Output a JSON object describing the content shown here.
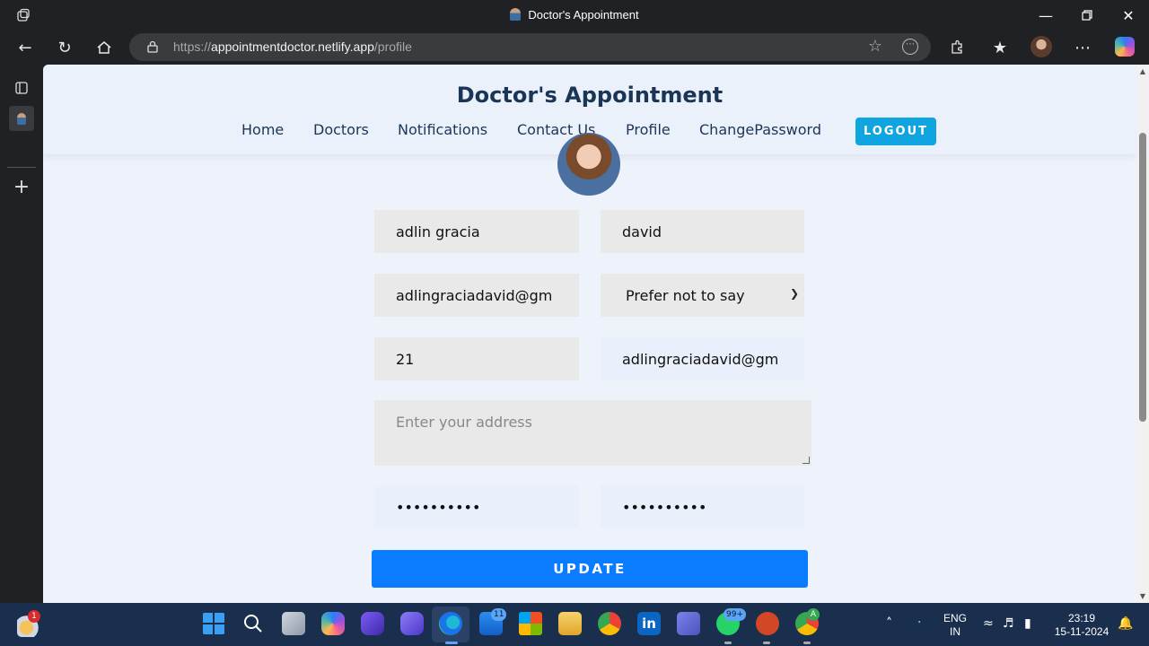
{
  "browser": {
    "tab_title": "Doctor's Appointment",
    "url_prefix": "https://",
    "url_host": "appointmentdoctor.netlify.app",
    "url_path": "/profile"
  },
  "site": {
    "brand": "Doctor's Appointment",
    "nav": [
      "Home",
      "Doctors",
      "Notifications",
      "Contact Us",
      "Profile",
      "ChangePassword"
    ],
    "logout_label": "LOGOUT"
  },
  "form": {
    "first_name": "adlin gracia",
    "last_name": "david",
    "email": "adlingraciadavid@gm",
    "gender": "Prefer not to say",
    "age": "21",
    "email_secondary": "adlingraciadavid@gm",
    "address_placeholder": "Enter your address",
    "password": "••••••••••",
    "confirm_password": "••••••••••",
    "update_label": "UPDATE"
  },
  "taskbar": {
    "widgets_badge": "1",
    "mail_badge": "11",
    "whatsapp_badge": "99+",
    "chrome_profile_letter": "A",
    "lang_line1": "ENG",
    "lang_line2": "IN",
    "time": "23:19",
    "date": "15-11-2024"
  },
  "colors": {
    "brand_text": "#1b3557",
    "logout_bg": "#10a5e0",
    "update_bg": "#0a7cff",
    "page_bg": "#eef3fb"
  }
}
